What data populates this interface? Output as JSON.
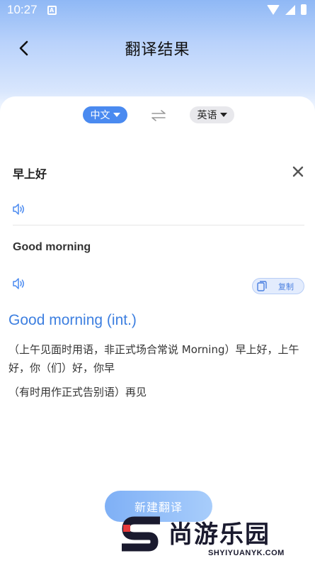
{
  "status": {
    "time": "10:27",
    "notif_glyph": "A"
  },
  "header": {
    "title": "翻译结果",
    "back_icon": "chevron-left-icon"
  },
  "languages": {
    "source": "中文",
    "target": "英语",
    "swap_icon": "swap-arrows-icon"
  },
  "source": {
    "text": "早上好",
    "clear_icon": "close-icon",
    "speak_icon": "speaker-icon"
  },
  "target": {
    "text": "Good morning",
    "speak_icon": "speaker-icon",
    "copy_label": "复制",
    "copy_icon": "copy-icon"
  },
  "dictionary": {
    "headword": "Good morning (int.)",
    "definition_1": "（上午见面时用语，非正式场合常说 Morning）早上好，上午好，你（们）好，你早",
    "definition_2": "（有时用作正式告别语）再见"
  },
  "actions": {
    "new_translation": "新建翻译"
  },
  "watermark": {
    "name": "尚游乐园",
    "url": "SHYIYUANYK.COM"
  },
  "colors": {
    "accent": "#4a8af0",
    "headword": "#3d7fe0"
  }
}
